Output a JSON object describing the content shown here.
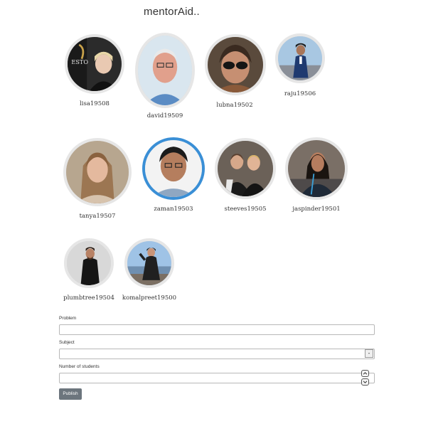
{
  "app": {
    "title": "mentorAid.."
  },
  "mentors": [
    {
      "username": "lisa19508"
    },
    {
      "username": "david19509"
    },
    {
      "username": "lubna19502"
    },
    {
      "username": "raju19506"
    },
    {
      "username": "tanya19507"
    },
    {
      "username": "zaman19503",
      "selected": true
    },
    {
      "username": "steeves19505"
    },
    {
      "username": "jaspinder19501"
    },
    {
      "username": "plumbtree19504"
    },
    {
      "username": "komalpreet19500"
    }
  ],
  "form": {
    "problem_label": "Problem",
    "problem_value": "",
    "subject_label": "Subject",
    "subject_value": "",
    "subject_dropdown_glyph": "-",
    "students_label": "Number of students",
    "students_value": "",
    "publish_label": "Publish"
  },
  "colors": {
    "selected_ring": "#3a8fd6",
    "publish_button": "#6c757d"
  },
  "icons": {
    "spinner_up": "chevron-up-icon",
    "spinner_down": "chevron-down-icon"
  }
}
